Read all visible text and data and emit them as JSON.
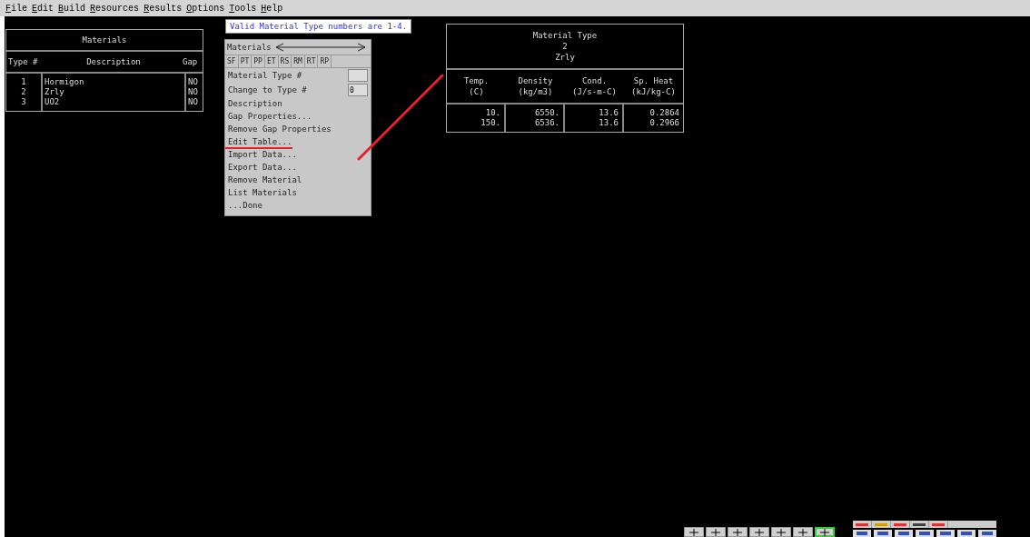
{
  "menu": [
    "File",
    "Edit",
    "Build",
    "Resources",
    "Results",
    "Options",
    "Tools",
    "Help"
  ],
  "hint": "Valid Material Type numbers are 1-4.",
  "materials_table": {
    "title": "Materials",
    "columns": [
      "Type #",
      "Description",
      "Gap"
    ],
    "rows": [
      {
        "type": "1",
        "description": "Hormigon",
        "gap": "NO"
      },
      {
        "type": "2",
        "description": "Zrly",
        "gap": "NO"
      },
      {
        "type": "3",
        "description": "UO2",
        "gap": "NO"
      }
    ]
  },
  "panel": {
    "title": "Materials",
    "tabs": [
      "SF",
      "PT",
      "PP",
      "ET",
      "RS",
      "RM",
      "RT",
      "RP"
    ],
    "fields": [
      {
        "label": "Material Type #"
      },
      {
        "label": "Change to Type #",
        "value": "0"
      }
    ],
    "items": [
      {
        "label": "Description",
        "marked": false
      },
      {
        "label": "Gap Properties...",
        "marked": false
      },
      {
        "label": "Remove Gap Properties",
        "marked": false
      },
      {
        "label": "Edit Table...",
        "marked": true
      },
      {
        "label": "Import Data...",
        "marked": false
      },
      {
        "label": "Export Data...",
        "marked": false
      },
      {
        "label": "Remove Material",
        "marked": false
      },
      {
        "label": "List Materials",
        "marked": false
      },
      {
        "label": "...Done",
        "marked": false
      }
    ]
  },
  "property_table": {
    "title": [
      "Material Type",
      "2",
      "Zrly"
    ],
    "header_rows": [
      [
        "Temp.",
        "Density",
        "Cond.",
        "Sp. Heat"
      ],
      [
        "(C)",
        "(kg/m3)",
        "(J/s-m-C)",
        "(kJ/kg-C)"
      ]
    ],
    "rows": [
      [
        "10.",
        "6550.",
        "13.6",
        "0.2864"
      ],
      [
        "150.",
        "6536.",
        "13.6",
        "0.2966"
      ]
    ]
  }
}
